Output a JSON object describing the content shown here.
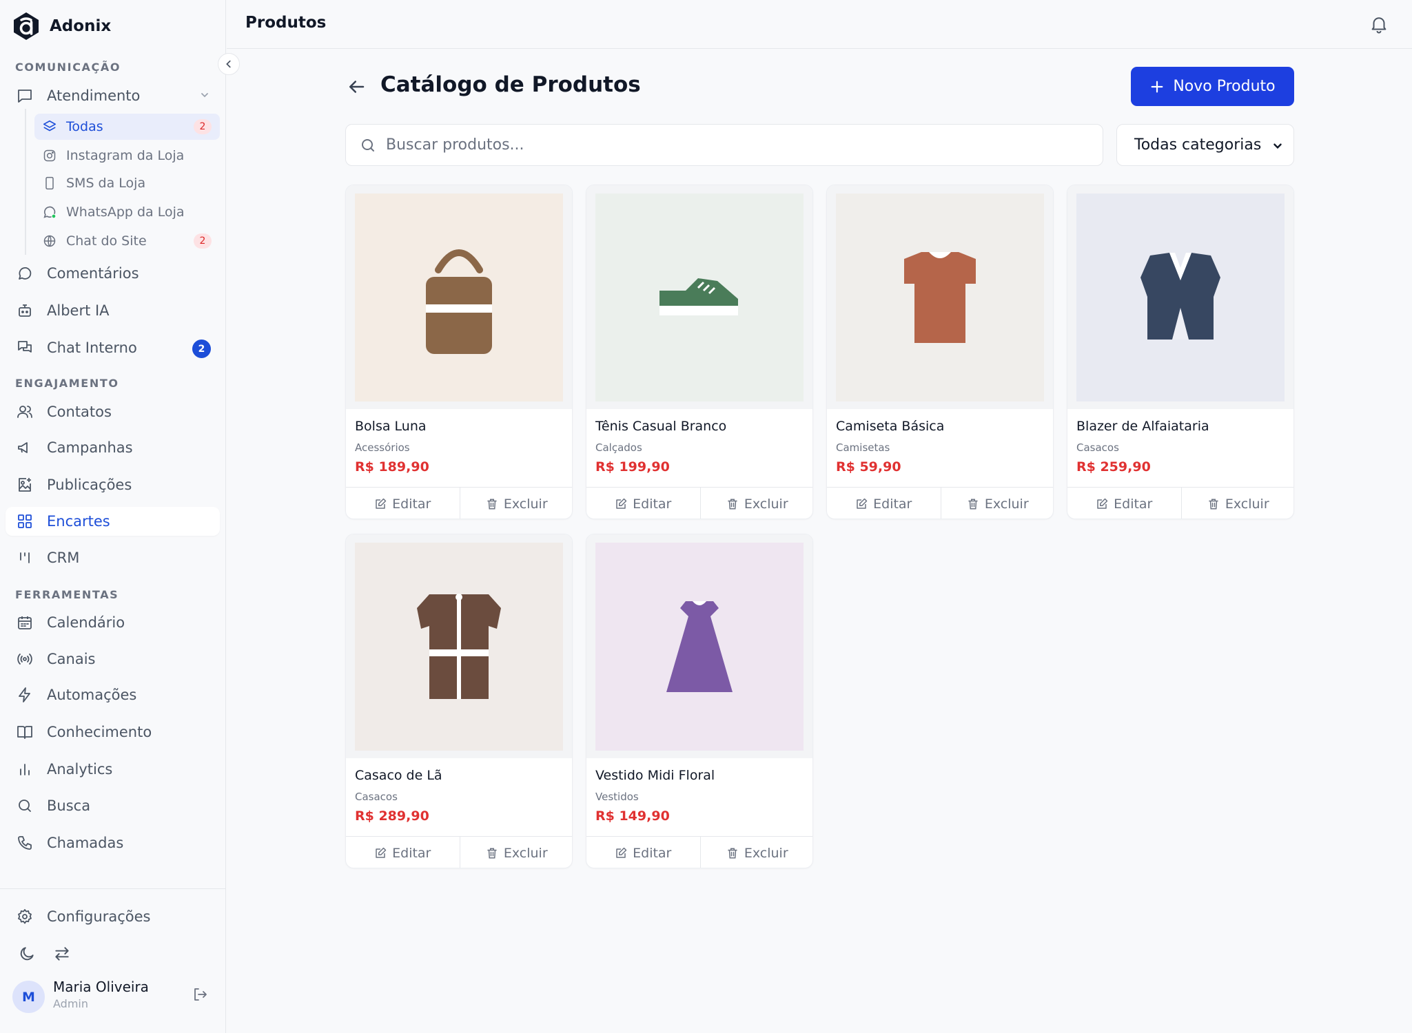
{
  "app": {
    "name": "Adonix"
  },
  "sidebar": {
    "sections": {
      "communication": "COMUNICAÇÃO",
      "engagement": "ENGAJAMENTO",
      "tools": "FERRAMENTAS"
    },
    "atendimento": {
      "label": "Atendimento",
      "subitems": [
        {
          "label": "Todas",
          "badge": "2"
        },
        {
          "label": "Instagram da Loja"
        },
        {
          "label": "SMS da Loja"
        },
        {
          "label": "WhatsApp da Loja"
        },
        {
          "label": "Chat do Site",
          "badge": "2"
        }
      ]
    },
    "communication_items": [
      {
        "label": "Comentários",
        "icon": "message-circle-icon"
      },
      {
        "label": "Albert IA",
        "icon": "bot-icon"
      },
      {
        "label": "Chat Interno",
        "icon": "messages-icon",
        "badge": "2"
      }
    ],
    "engagement_items": [
      {
        "label": "Contatos",
        "icon": "users-icon"
      },
      {
        "label": "Campanhas",
        "icon": "megaphone-icon"
      },
      {
        "label": "Publicações",
        "icon": "image-plus-icon"
      },
      {
        "label": "Encartes",
        "icon": "grid-icon",
        "active": true
      },
      {
        "label": "CRM",
        "icon": "kanban-icon"
      }
    ],
    "tool_items": [
      {
        "label": "Calendário",
        "icon": "calendar-icon"
      },
      {
        "label": "Canais",
        "icon": "radio-icon"
      },
      {
        "label": "Automações",
        "icon": "zap-icon"
      },
      {
        "label": "Conhecimento",
        "icon": "book-icon"
      },
      {
        "label": "Analytics",
        "icon": "bar-chart-icon"
      },
      {
        "label": "Busca",
        "icon": "search-icon"
      },
      {
        "label": "Chamadas",
        "icon": "phone-icon"
      }
    ],
    "settings_label": "Configurações",
    "user": {
      "initial": "M",
      "name": "Maria Oliveira",
      "role": "Admin"
    }
  },
  "topbar": {
    "title": "Produtos"
  },
  "main": {
    "heading": "Catálogo de Produtos",
    "new_button": "Novo Produto",
    "search_placeholder": "Buscar produtos...",
    "category_filter": "Todas categorias",
    "edit_label": "Editar",
    "delete_label": "Excluir",
    "products": [
      {
        "name": "Bolsa Luna",
        "category": "Acessórios",
        "price": "R$ 189,90",
        "image": "bag",
        "bg": "#f4ece4",
        "color": "#8b6748"
      },
      {
        "name": "Tênis Casual Branco",
        "category": "Calçados",
        "price": "R$ 199,90",
        "image": "sneaker",
        "bg": "#ebf0ec",
        "color": "#4a7c59"
      },
      {
        "name": "Camiseta Básica",
        "category": "Camisetas",
        "price": "R$ 59,90",
        "image": "tshirt",
        "bg": "#f0eeeb",
        "color": "#b5654a"
      },
      {
        "name": "Blazer de Alfaiataria",
        "category": "Casacos",
        "price": "R$ 259,90",
        "image": "blazer",
        "bg": "#e8eaf2",
        "color": "#374761"
      },
      {
        "name": "Casaco de Lã",
        "category": "Casacos",
        "price": "R$ 289,90",
        "image": "coat",
        "bg": "#f0ebe8",
        "color": "#6b4c3e"
      },
      {
        "name": "Vestido Midi Floral",
        "category": "Vestidos",
        "price": "R$ 149,90",
        "image": "dress",
        "bg": "#efe6f1",
        "color": "#7c5aa6"
      }
    ]
  },
  "colors": {
    "accent": "#1d3fe0",
    "price": "#e03131",
    "badge_pink_bg": "#fde2e4"
  }
}
